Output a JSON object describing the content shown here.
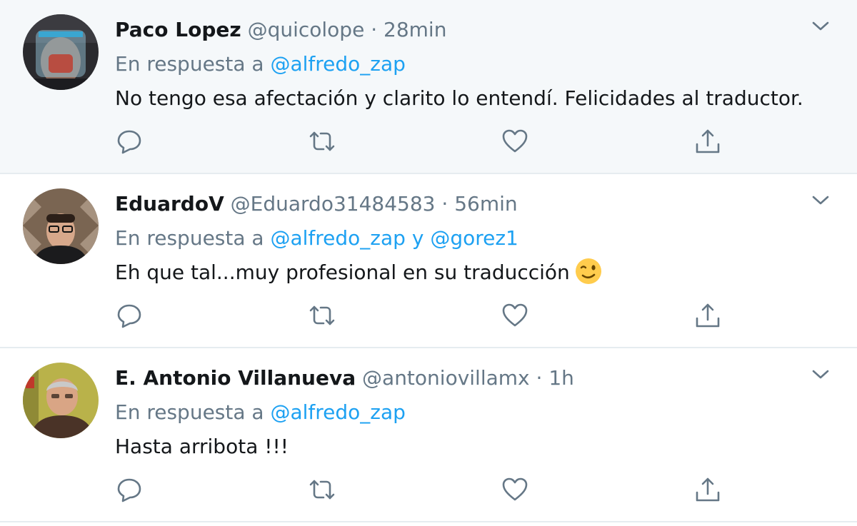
{
  "tweets": [
    {
      "name": "Paco Lopez",
      "handle": "@quicolope",
      "time": "· 28min",
      "reply_prefix": "En respuesta a ",
      "mentions": [
        "@alfredo_zap"
      ],
      "connector": "",
      "text": "No tengo esa afectación y clarito lo entendí. Felicidades al traductor.",
      "emoji": "",
      "highlighted": true
    },
    {
      "name": "EduardoV",
      "handle": "@Eduardo31484583",
      "time": "· 56min",
      "reply_prefix": "En respuesta a ",
      "mentions": [
        "@alfredo_zap",
        "@gorez1"
      ],
      "connector": " y ",
      "text": "Eh que tal...muy profesional en su traducción",
      "emoji": "winking-face",
      "highlighted": false
    },
    {
      "name": "E. Antonio Villanueva",
      "handle": "@antoniovillamx",
      "time": "· 1h",
      "reply_prefix": "En respuesta a ",
      "mentions": [
        "@alfredo_zap"
      ],
      "connector": "",
      "text": "Hasta arribota !!!",
      "emoji": "",
      "highlighted": false
    }
  ],
  "icons": {
    "reply": "reply-icon",
    "retweet": "retweet-icon",
    "like": "like-icon",
    "share": "share-icon",
    "more": "chevron-down-icon"
  },
  "colors": {
    "mention": "#1da1f2",
    "secondary_text": "#657786",
    "primary_text": "#14171a",
    "highlight_bg": "#f5f8fa",
    "divider": "#e6ecf0"
  }
}
